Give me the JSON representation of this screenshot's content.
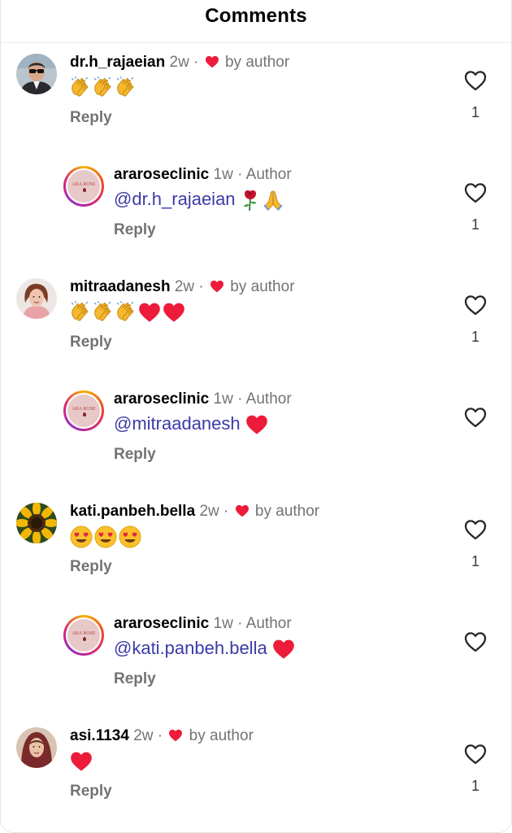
{
  "header": {
    "title": "Comments"
  },
  "colors": {
    "heart_red": "#ed1c3a",
    "mention_blue": "#3b3ba8",
    "muted": "#737373"
  },
  "comments": [
    {
      "username": "dr.h_rajaeian",
      "time": "2w",
      "separator": "·",
      "by_author": "by author",
      "emoji_text": "👏👏👏",
      "reply_label": "Reply",
      "likes": "1",
      "avatar_icon": "man-sunglasses-avatar"
    },
    {
      "username": "araroseclinic",
      "time": "1w",
      "separator": "·",
      "author_tag": "Author",
      "mention": "@dr.h_rajaeian",
      "emoji_text": "🌹🙏",
      "reply_label": "Reply",
      "likes": "1",
      "avatar_icon": "clinic-logo-avatar",
      "logo_text": "ARA ROSE"
    },
    {
      "username": "mitraadanesh",
      "time": "2w",
      "separator": "·",
      "by_author": "by author",
      "emoji_text": "👏👏👏❤️❤️",
      "reply_label": "Reply",
      "likes": "1",
      "avatar_icon": "woman-avatar"
    },
    {
      "username": "araroseclinic",
      "time": "1w",
      "separator": "·",
      "author_tag": "Author",
      "mention": "@mitraadanesh",
      "emoji_text": "❤️",
      "reply_label": "Reply",
      "likes": "",
      "avatar_icon": "clinic-logo-avatar",
      "logo_text": "ARA ROSE"
    },
    {
      "username": "kati.panbeh.bella",
      "time": "2w",
      "separator": "·",
      "by_author": "by author",
      "emoji_text": "😍😍😍",
      "reply_label": "Reply",
      "likes": "1",
      "avatar_icon": "sunflower-avatar"
    },
    {
      "username": "araroseclinic",
      "time": "1w",
      "separator": "·",
      "author_tag": "Author",
      "mention": "@kati.panbeh.bella",
      "emoji_text": "❤️",
      "reply_label": "Reply",
      "likes": "",
      "avatar_icon": "clinic-logo-avatar",
      "logo_text": "ARA ROSE"
    },
    {
      "username": "asi.1134",
      "time": "2w",
      "separator": "·",
      "by_author": "by author",
      "emoji_text": "❤️",
      "reply_label": "Reply",
      "likes": "1",
      "avatar_icon": "woman-hijab-avatar"
    }
  ]
}
